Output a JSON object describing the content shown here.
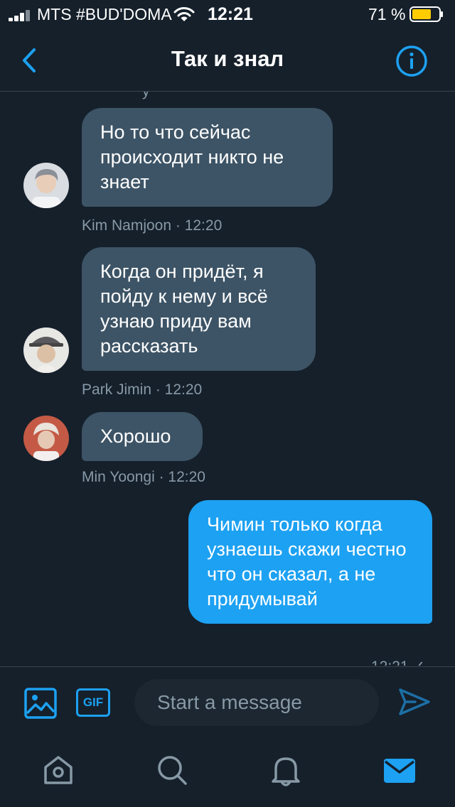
{
  "status": {
    "carrier": "MTS #BUD'DOMA",
    "time": "12:21",
    "battery": "71 %",
    "battery_level": 0.71,
    "battery_color": "#ffcc00"
  },
  "header": {
    "title": "Так и знал",
    "back_icon": "chevron-left-icon",
    "info_icon": "info-icon",
    "accent": "#1da1f2"
  },
  "messages": [
    {
      "direction": "in",
      "text": "Но то что сейчас происходит никто не знает",
      "sender": "Kim Namjoon",
      "time": "12:20",
      "meta": "Kim Namjoon · 12:20"
    },
    {
      "direction": "in",
      "text": "Когда он придёт, я пойду к нему и всё узнаю приду вам рассказать",
      "sender": "Park Jimin",
      "time": "12:20",
      "meta": "Park Jimin · 12:20"
    },
    {
      "direction": "in",
      "text": "Хорошо",
      "sender": "Min Yoongi",
      "time": "12:20",
      "meta": "Min Yoongi · 12:20"
    },
    {
      "direction": "out",
      "text": "Чимин только когда узнаешь скажи честно что он сказал, а не придумывай"
    }
  ],
  "composer": {
    "placeholder": "Start a message",
    "gif_label": "GIF",
    "media_icon": "image-icon",
    "send_icon": "send-icon"
  },
  "tabs": [
    {
      "name": "home",
      "icon": "home-icon"
    },
    {
      "name": "search",
      "icon": "search-icon"
    },
    {
      "name": "notifications",
      "icon": "bell-icon"
    },
    {
      "name": "messages",
      "icon": "mail-icon",
      "active": true
    }
  ]
}
